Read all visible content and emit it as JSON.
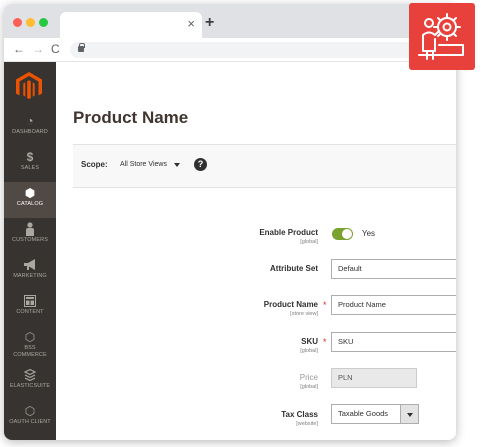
{
  "browser": {
    "tab_close": "×",
    "new_tab": "+",
    "nav": {
      "back": "←",
      "forward": "→",
      "reload": "C"
    }
  },
  "sidebar": {
    "items": [
      {
        "label": "DASHBOARD",
        "icon": "dashboard-icon",
        "glyph": "◔"
      },
      {
        "label": "SALES",
        "icon": "dollar-icon",
        "glyph": "$"
      },
      {
        "label": "CATALOG",
        "icon": "box-icon",
        "glyph": "⬢",
        "active": true
      },
      {
        "label": "CUSTOMERS",
        "icon": "person-icon",
        "glyph": "👤"
      },
      {
        "label": "MARKETING",
        "icon": "megaphone-icon",
        "glyph": "📢"
      },
      {
        "label": "CONTENT",
        "icon": "layout-icon",
        "glyph": "▦"
      },
      {
        "label": "BSS",
        "label2": "COMMERCE",
        "icon": "hexagon-icon",
        "glyph": "⬡"
      },
      {
        "label": "ELASTICSUITE",
        "icon": "elasticsuite-icon",
        "glyph": "⧉"
      },
      {
        "label": "OAUTH CLIENT",
        "icon": "hexagon-icon",
        "glyph": "⬡"
      }
    ]
  },
  "page": {
    "title": "Product Name",
    "scope": {
      "label": "Scope:",
      "value": "All Store Views",
      "help": "?"
    }
  },
  "form": {
    "enable_product": {
      "label": "Enable Product",
      "scope": "[global]",
      "value": "Yes"
    },
    "attribute_set": {
      "label": "Attribute Set",
      "value": "Default"
    },
    "product_name": {
      "label": "Product Name",
      "scope": "[store view]",
      "value": "Product Name",
      "required": "*"
    },
    "sku": {
      "label": "SKU",
      "scope": "[global]",
      "value": "SKU",
      "required": "*"
    },
    "price": {
      "label": "Price",
      "scope": "[global]",
      "value": "PLN"
    },
    "tax_class": {
      "label": "Tax Class",
      "scope": "[website]",
      "value": "Taxable Goods"
    }
  },
  "colors": {
    "magento_orange": "#eb5202",
    "sidebar_bg": "#373330",
    "toggle_on": "#79a22e",
    "badge_red": "#e8403a"
  }
}
